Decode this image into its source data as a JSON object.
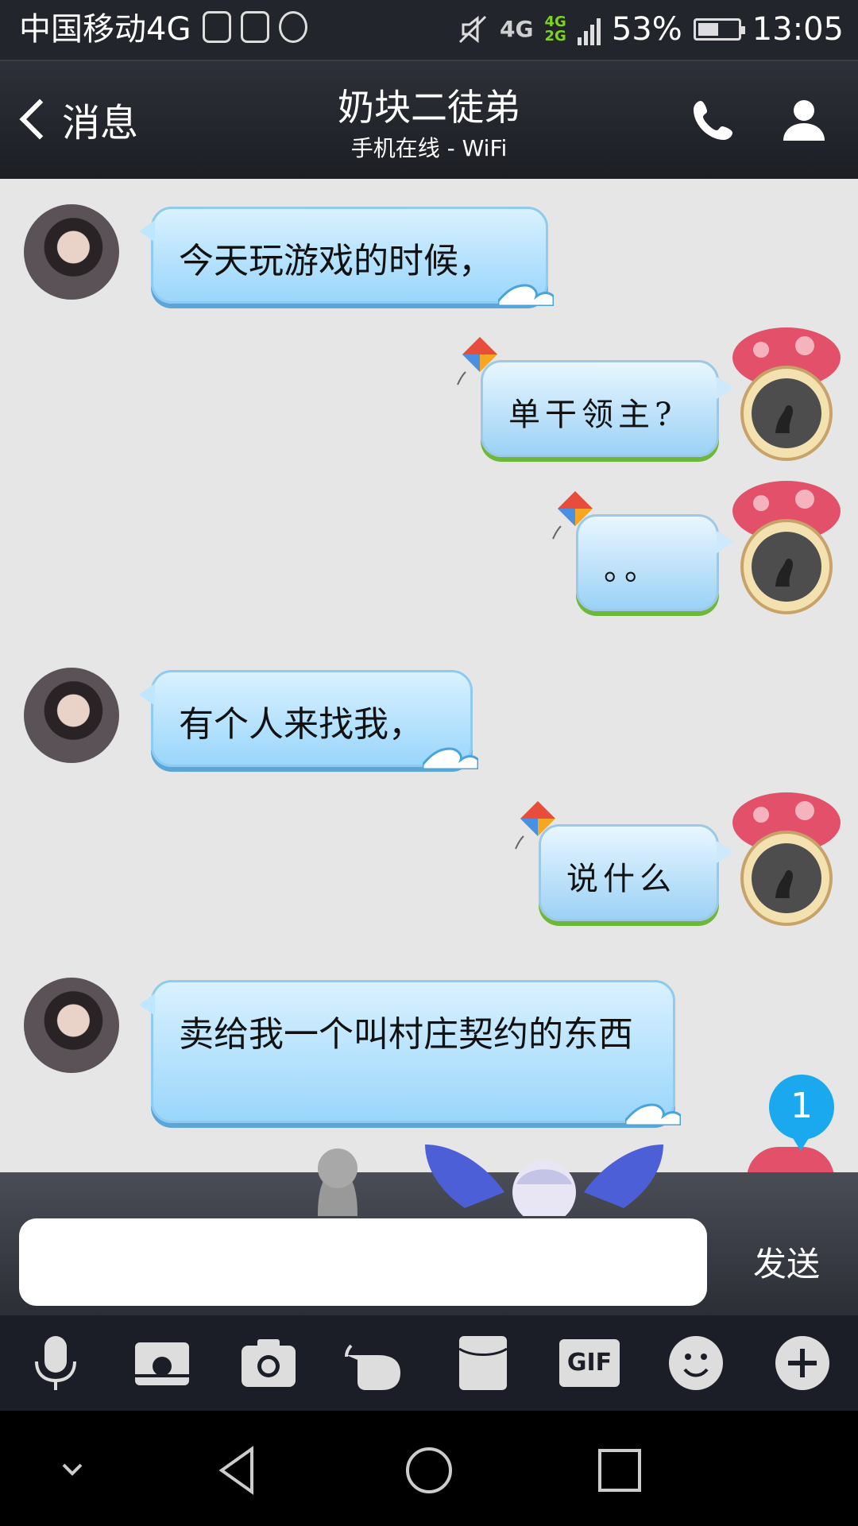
{
  "status_bar": {
    "carrier": "中国移动4G",
    "network_top": "4G",
    "network_bottom": "2G",
    "network_main": "4G",
    "battery_pct": "53%",
    "battery_level": 0.53,
    "time": "13:05"
  },
  "header": {
    "back_label": "消息",
    "title": "奶块二徒弟",
    "subtitle": "手机在线 - WiFi"
  },
  "messages": [
    {
      "side": "left",
      "text": "今天玩游戏的时候，"
    },
    {
      "side": "right",
      "text": "单干领主?"
    },
    {
      "side": "right",
      "text": "。。"
    },
    {
      "side": "left",
      "text": "有个人来找我，"
    },
    {
      "side": "right",
      "text": "说什么"
    },
    {
      "side": "left",
      "text": "卖给我一个叫村庄契约的东西"
    }
  ],
  "unread_badge": "1",
  "input": {
    "value": "",
    "send_label": "发送"
  },
  "toolbar": {
    "tools": [
      "microphone-icon",
      "image-icon",
      "camera-icon",
      "poke-icon",
      "red-packet-icon",
      "gif-icon",
      "emoji-icon",
      "plus-icon"
    ],
    "gif_label": "GIF"
  },
  "colors": {
    "header_bg": "#22252c",
    "chat_bg": "#e6e6e6",
    "bubble_blue": "#9ad6fb",
    "badge_blue": "#1aa9ef"
  }
}
